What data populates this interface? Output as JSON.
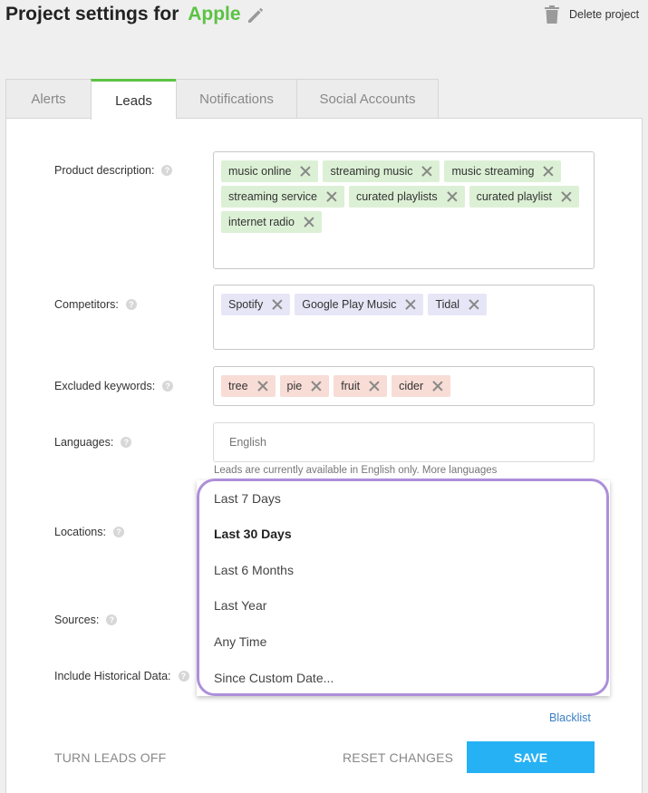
{
  "header": {
    "title_prefix": "Project settings for",
    "project_name": "Apple",
    "delete_label": "Delete project"
  },
  "tabs": [
    {
      "label": "Alerts",
      "active": false
    },
    {
      "label": "Leads",
      "active": true
    },
    {
      "label": "Notifications",
      "active": false
    },
    {
      "label": "Social Accounts",
      "active": false
    }
  ],
  "fields": {
    "product_description": {
      "label": "Product description:",
      "tags": [
        "music online",
        "streaming music",
        "music streaming",
        "streaming service",
        "curated playlists",
        "curated playlist",
        "internet radio"
      ]
    },
    "competitors": {
      "label": "Competitors:",
      "tags": [
        "Spotify",
        "Google Play Music",
        "Tidal"
      ]
    },
    "excluded_keywords": {
      "label": "Excluded keywords:",
      "tags": [
        "tree",
        "pie",
        "fruit",
        "cider"
      ]
    },
    "languages": {
      "label": "Languages:",
      "placeholder": "English",
      "note": "Leads are currently available in English only. More languages"
    },
    "locations": {
      "label": "Locations:"
    },
    "sources": {
      "label": "Sources:"
    },
    "historical": {
      "label": "Include Historical Data:"
    }
  },
  "dropdown": {
    "options": [
      "Last 7 Days",
      "Last 30 Days",
      "Last 6 Months",
      "Last Year",
      "Any Time",
      "Since Custom Date..."
    ],
    "selected": "Last 30 Days"
  },
  "footer": {
    "blacklist_label": "Blacklist",
    "turn_off_label": "TURN LEADS OFF",
    "reset_label": "RESET CHANGES",
    "save_label": "SAVE"
  },
  "colors": {
    "accent_green": "#5cc244",
    "save_blue": "#26b1f5",
    "highlight_purple": "#ad8fd9"
  }
}
